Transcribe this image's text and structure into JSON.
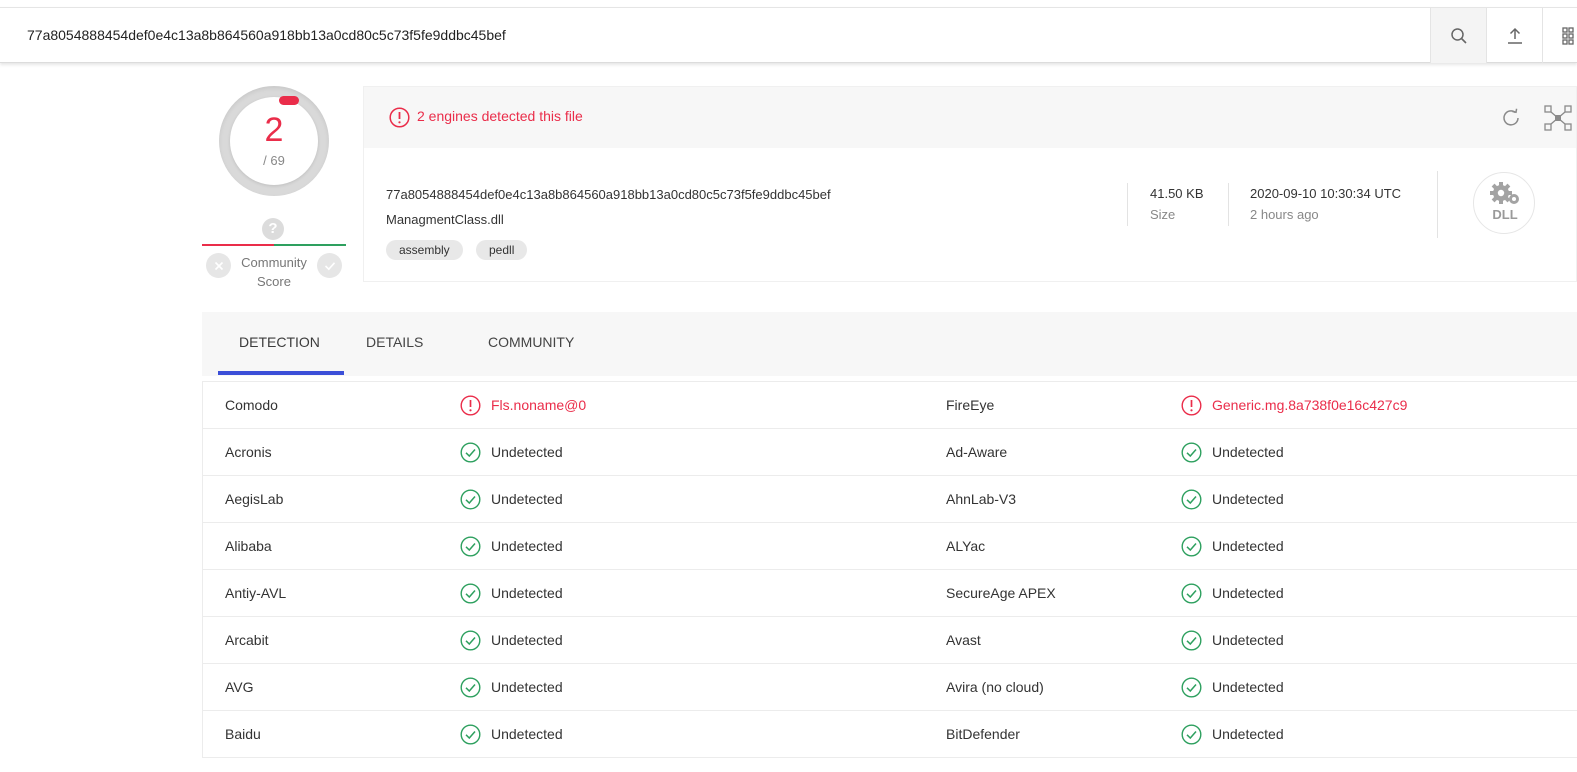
{
  "search": {
    "value": "77a8054888454def0e4c13a8b864560a918bb13a0cd80c5c73f5fe9ddbc45bef"
  },
  "score": {
    "detected": "2",
    "total": "/ 69"
  },
  "community": {
    "label": "Community Score",
    "unknown_glyph": "?"
  },
  "summary": {
    "detection_text": "2 engines detected this file"
  },
  "file": {
    "hash": "77a8054888454def0e4c13a8b864560a918bb13a0cd80c5c73f5fe9ddbc45bef",
    "name": "ManagmentClass.dll",
    "tags": [
      "assembly",
      "pedll"
    ],
    "size_value": "41.50 KB",
    "size_label": "Size",
    "date_value": "2020-09-10 10:30:34 UTC",
    "date_label": "2 hours ago",
    "type_badge": "DLL"
  },
  "tabs": [
    "DETECTION",
    "DETAILS",
    "COMMUNITY"
  ],
  "colors": {
    "danger": "#ea2d4a",
    "clean": "#2ea05f",
    "tab_accent": "#3b4fd8"
  },
  "detections": [
    {
      "engine1": "Comodo",
      "result1": "Fls.noname@0",
      "status1": "malicious",
      "engine2": "FireEye",
      "result2": "Generic.mg.8a738f0e16c427c9",
      "status2": "malicious"
    },
    {
      "engine1": "Acronis",
      "result1": "Undetected",
      "status1": "clean",
      "engine2": "Ad-Aware",
      "result2": "Undetected",
      "status2": "clean"
    },
    {
      "engine1": "AegisLab",
      "result1": "Undetected",
      "status1": "clean",
      "engine2": "AhnLab-V3",
      "result2": "Undetected",
      "status2": "clean"
    },
    {
      "engine1": "Alibaba",
      "result1": "Undetected",
      "status1": "clean",
      "engine2": "ALYac",
      "result2": "Undetected",
      "status2": "clean"
    },
    {
      "engine1": "Antiy-AVL",
      "result1": "Undetected",
      "status1": "clean",
      "engine2": "SecureAge APEX",
      "result2": "Undetected",
      "status2": "clean"
    },
    {
      "engine1": "Arcabit",
      "result1": "Undetected",
      "status1": "clean",
      "engine2": "Avast",
      "result2": "Undetected",
      "status2": "clean"
    },
    {
      "engine1": "AVG",
      "result1": "Undetected",
      "status1": "clean",
      "engine2": "Avira (no cloud)",
      "result2": "Undetected",
      "status2": "clean"
    },
    {
      "engine1": "Baidu",
      "result1": "Undetected",
      "status1": "clean",
      "engine2": "BitDefender",
      "result2": "Undetected",
      "status2": "clean"
    }
  ]
}
